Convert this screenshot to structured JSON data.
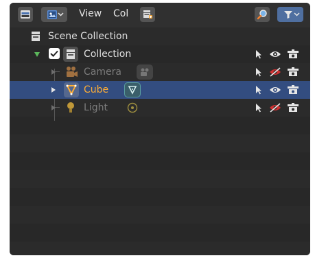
{
  "header": {
    "display_mode_icon": "outliner-display-icon",
    "editor_type_icon": "outliner-editor-icon",
    "menus": [
      "View",
      "Col"
    ],
    "new_collection_icon": "new-collection-icon",
    "search_icon": "search-icon",
    "filter_icon": "filter-icon"
  },
  "tree": [
    {
      "label": "Scene Collection",
      "icon": "scene-collection-icon",
      "state": "normal"
    },
    {
      "label": "Collection",
      "icon": "collection-icon",
      "state": "normal",
      "checked": true,
      "expanded": true
    },
    {
      "label": "Camera",
      "icon": "camera-icon",
      "state": "dim",
      "data_icon": "camera-data-icon",
      "hidden": true
    },
    {
      "label": "Cube",
      "icon": "mesh-icon",
      "state": "active",
      "data_icon": "mesh-data-icon",
      "hidden": false
    },
    {
      "label": "Light",
      "icon": "light-icon",
      "state": "dim",
      "data_icon": "light-data-icon",
      "hidden": true
    }
  ],
  "colors": {
    "selection": "#334d80",
    "active_text": "#ffae35",
    "dim_text": "#7c7c7c",
    "hidden_eye": "#d03030"
  }
}
